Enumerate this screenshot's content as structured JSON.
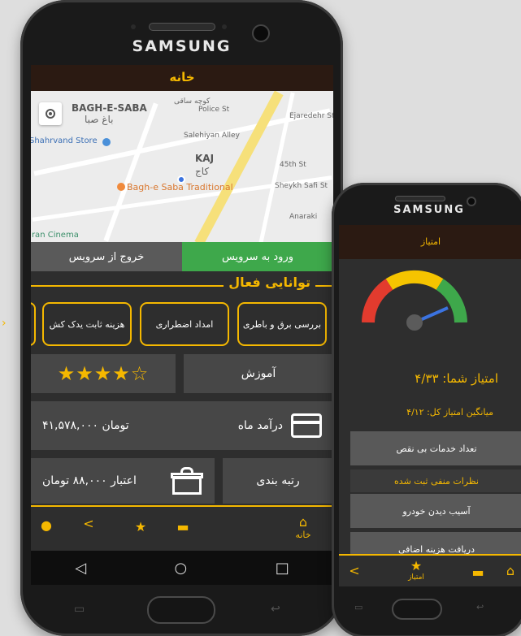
{
  "main_phone": {
    "brand": "SAMSUNG",
    "title": "خانه",
    "map": {
      "labels": [
        "BAGH-E-SABA",
        "باغ صبا",
        "Shahrvand Store",
        "KAJ",
        "کاج",
        "Bagh-e Saba Traditional",
        "Iran Cinema",
        "Police St",
        "Salehiyan Alley",
        "45th St",
        "Sheykh Safi St",
        "Anaraki",
        "Ejaredehr St",
        "کوچه ساقی"
      ]
    },
    "service": {
      "exit_label": "خروج از سرویس",
      "enter_label": "ورود به سرویس"
    },
    "section_title": "توانایی فعال",
    "skills": [
      "بررسی برق و باطری",
      "امداد اضطراری",
      "هزینه ثابت یدک کش"
    ],
    "training": {
      "label": "آموزش",
      "rating": 4,
      "max_rating": 5,
      "stars_text": "★★★★☆"
    },
    "income": {
      "label": "درآمد ماه",
      "value": "۴۱,۵۷۸,۰۰۰ تومان"
    },
    "credit": {
      "rank_label": "رتبه بندی",
      "value": "اعتبار ۸۸,۰۰۰ تومان"
    },
    "bottom_nav": {
      "home_label": "خانه"
    },
    "android": {
      "back": "◁",
      "home": "○",
      "recent": "□"
    },
    "icons": [
      "locate-icon",
      "card-icon",
      "gift-icon",
      "home-icon",
      "wallet-icon",
      "star-icon",
      "share-icon",
      "user-icon"
    ]
  },
  "side_phone": {
    "brand": "SAMSUNG",
    "title": "امتیاز",
    "gauge": {
      "min_label": "0",
      "max_label": "5",
      "value": 4.33
    },
    "score": "امتیاز شما:  ۴/۳۳",
    "average": "میانگین امتیاز کل: ۴/۱۲",
    "items": [
      {
        "label": "تعداد خدمات بی نقص",
        "style": "gray"
      },
      {
        "label": "نظرات منفی ثبت شده",
        "style": "dark"
      },
      {
        "label": "آسیب دیدن خودرو",
        "style": "gray"
      },
      {
        "label": "دریافت هزینه اضافی",
        "style": "gray"
      }
    ],
    "bottom_nav": {
      "rating_label": "امتیاز"
    }
  },
  "colors": {
    "accent": "#f5b800",
    "green": "#3ea84b",
    "title_bg": "#2b1a12",
    "bg": "#2e2e2e"
  }
}
